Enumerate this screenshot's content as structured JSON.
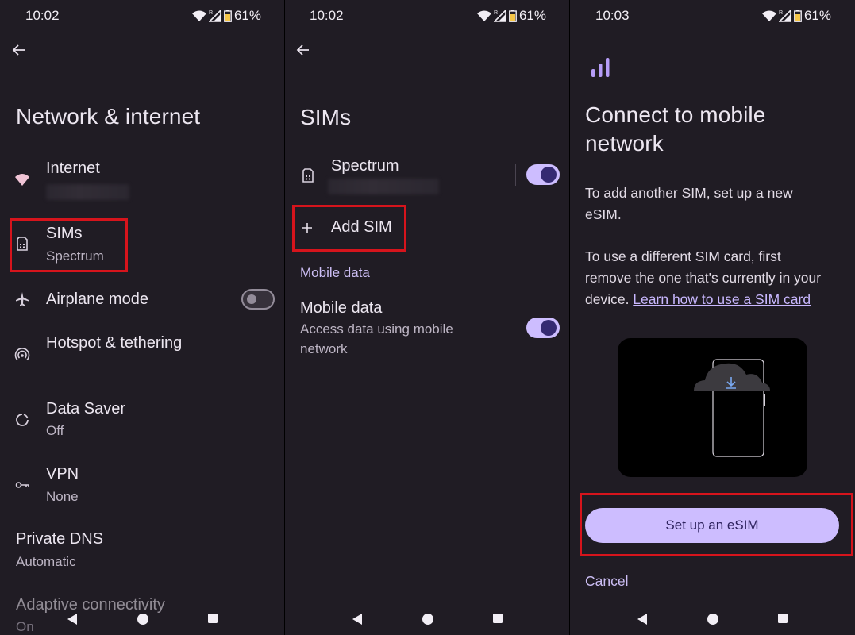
{
  "status": [
    {
      "time": "10:02",
      "battery": "61%",
      "roaming": "R"
    },
    {
      "time": "10:02",
      "battery": "61%",
      "roaming": "R"
    },
    {
      "time": "10:03",
      "battery": "61%",
      "roaming": "R"
    }
  ],
  "screen1": {
    "title": "Network & internet",
    "items": [
      {
        "title": "Internet",
        "subtitle": "",
        "icon": "wifi-icon"
      },
      {
        "title": "SIMs",
        "subtitle": "Spectrum",
        "icon": "sim-card-icon"
      },
      {
        "title": "Airplane mode",
        "subtitle": "",
        "icon": "airplane-icon",
        "toggle": "off"
      },
      {
        "title": "Hotspot & tethering",
        "subtitle": "",
        "icon": "hotspot-icon"
      },
      {
        "title": "Data Saver",
        "subtitle": "Off",
        "icon": "data-saver-icon"
      },
      {
        "title": "VPN",
        "subtitle": "None",
        "icon": "vpn-key-icon"
      },
      {
        "title": "Private DNS",
        "subtitle": "Automatic"
      },
      {
        "title": "Adaptive connectivity",
        "subtitle": "On"
      }
    ]
  },
  "screen2": {
    "title": "SIMs",
    "sim_name": "Spectrum",
    "sim_toggle": "on",
    "add_sim": "Add SIM",
    "section": "Mobile data",
    "mobile_data_title": "Mobile data",
    "mobile_data_sub_1": "Access data using mobile",
    "mobile_data_sub_2": "network",
    "mobile_data_toggle": "on"
  },
  "screen3": {
    "title_line1": "Connect to mobile",
    "title_line2": "network",
    "para1_line1": "To add another SIM, set up a new",
    "para1_line2": "eSIM.",
    "para2_line1": "To use a different SIM card, first",
    "para2_line2": "remove the one that's currently in your",
    "para2_line3": "device.",
    "link": "Learn how to use a SIM card",
    "primary_button": "Set up an eSIM",
    "cancel": "Cancel"
  },
  "colors": {
    "background": "#201c24",
    "accent": "#cdbdff",
    "highlight": "#d6141c"
  }
}
